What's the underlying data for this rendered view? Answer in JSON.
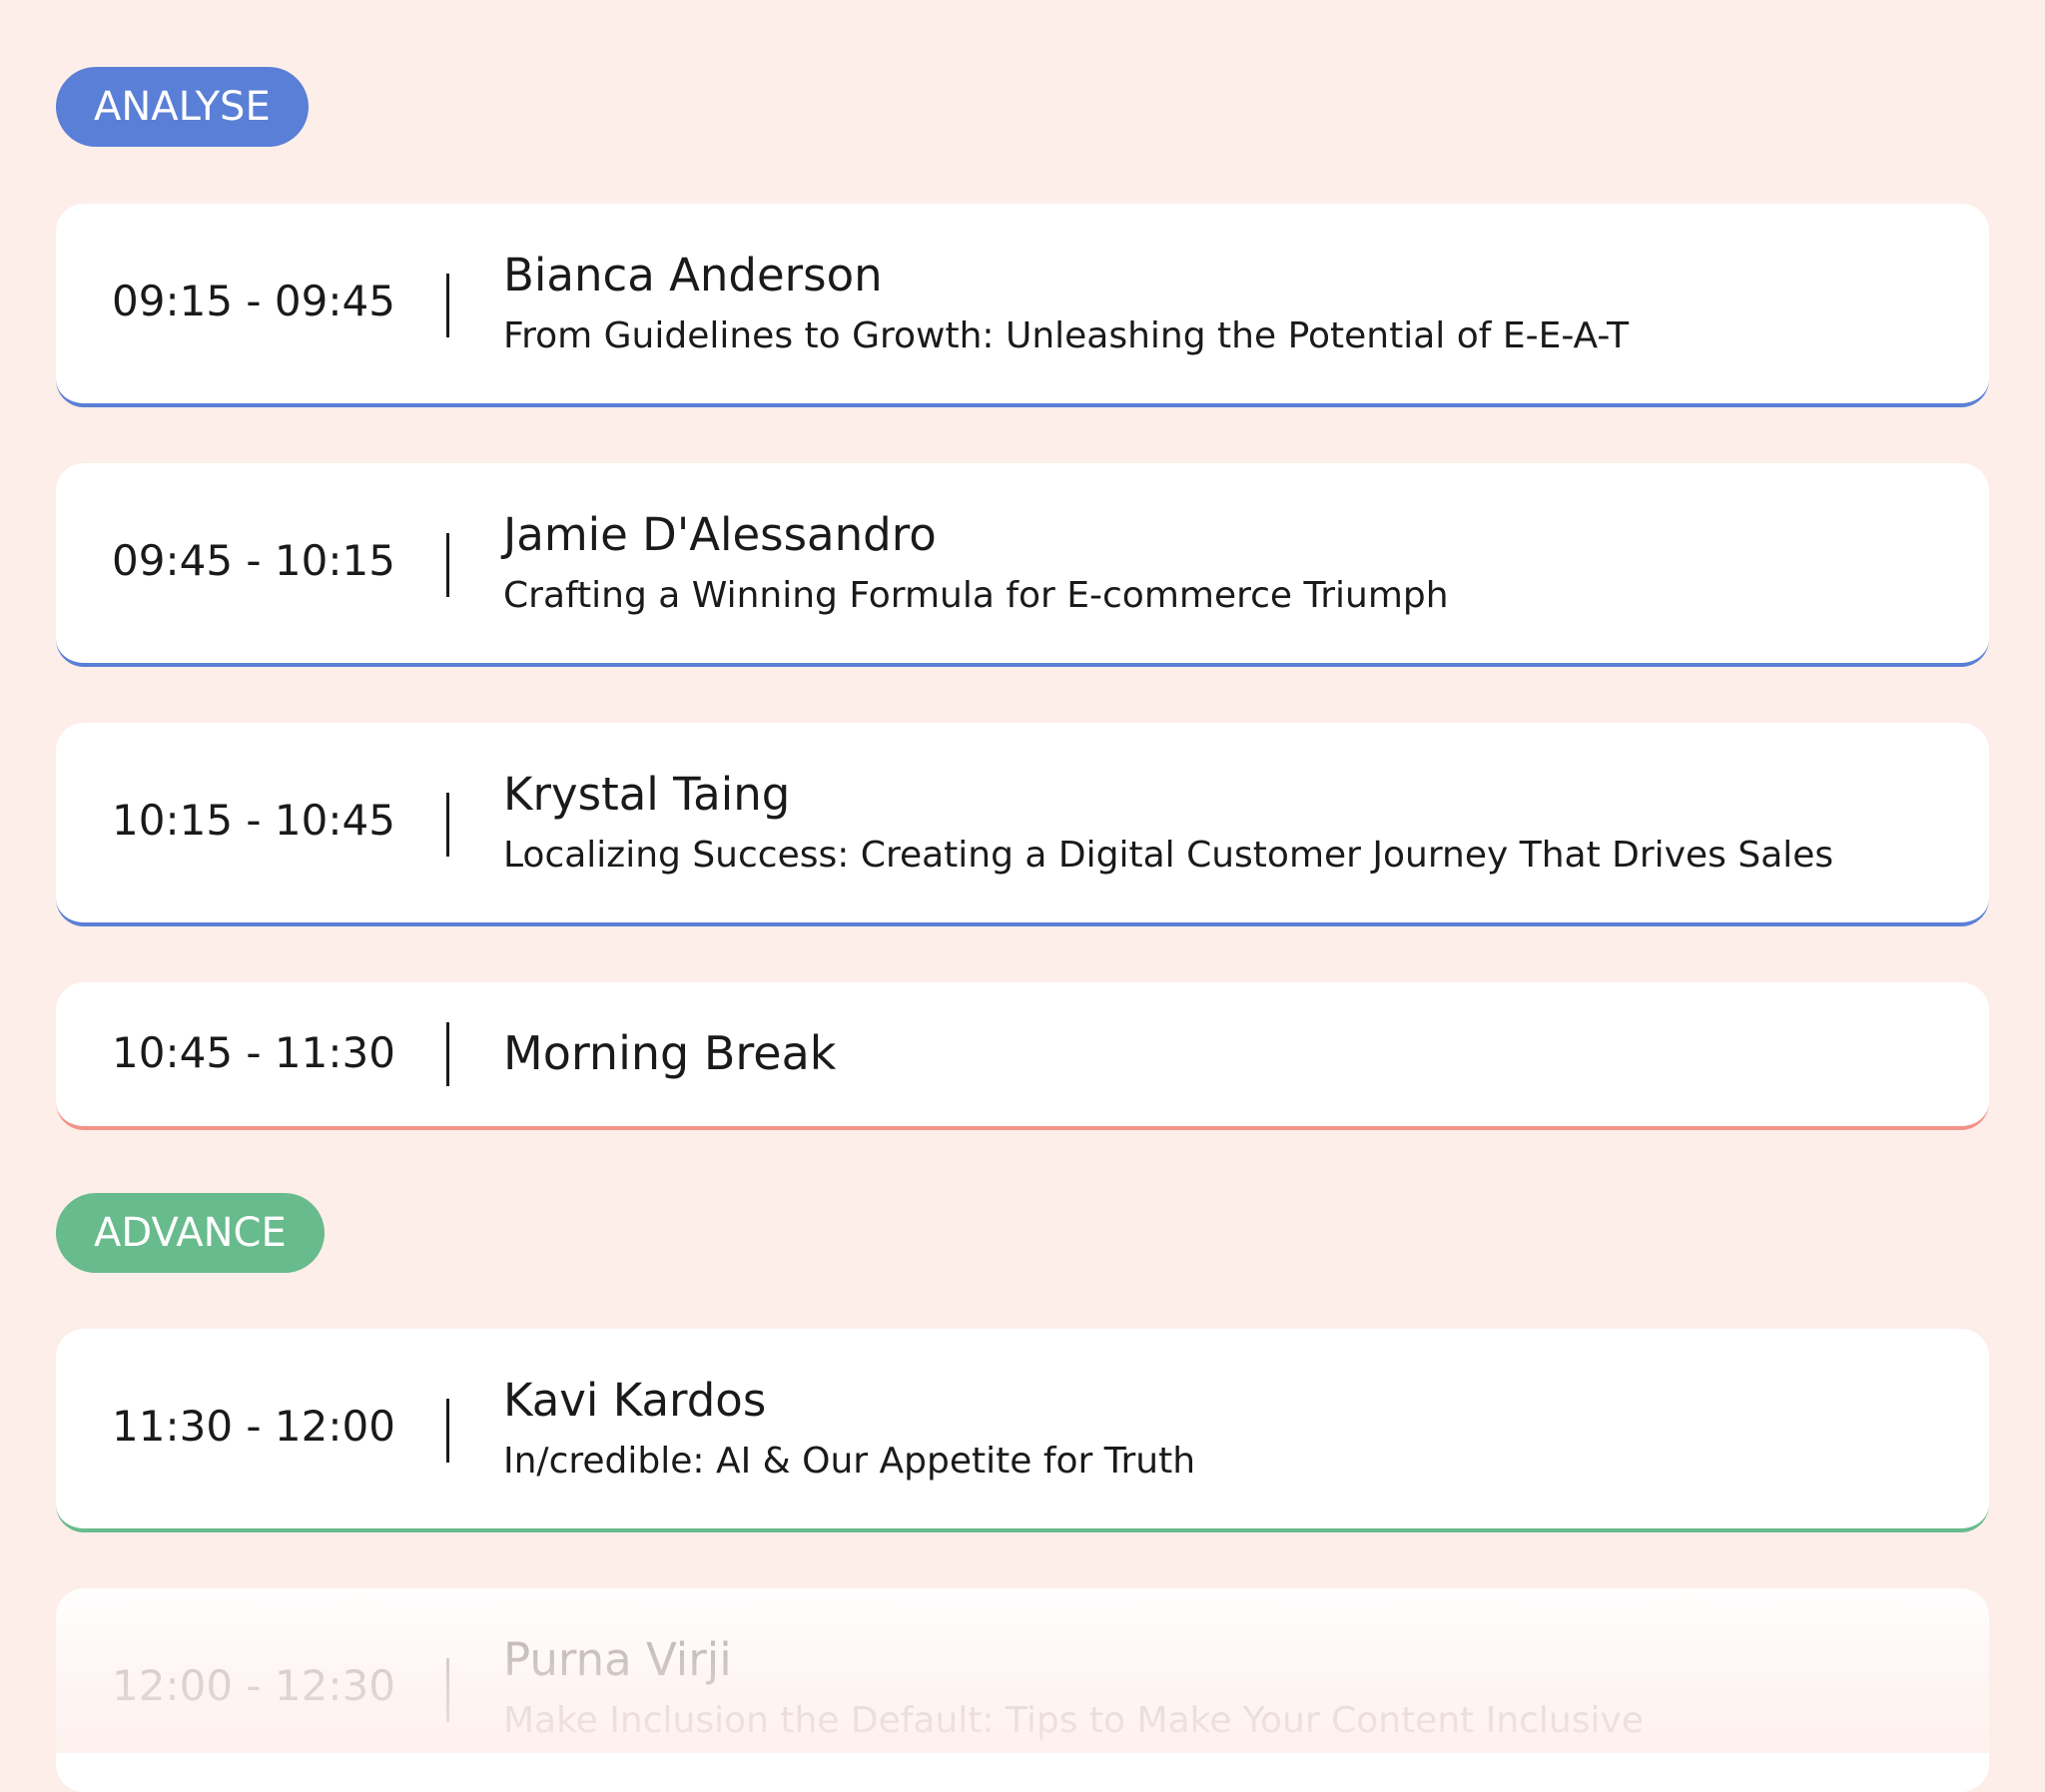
{
  "tracks": {
    "analyse": {
      "label": "ANALYSE",
      "color": "#5a7fd6"
    },
    "advance": {
      "label": "ADVANCE",
      "color": "#68bb8c"
    }
  },
  "break_color": "#f2938a",
  "sessions": [
    {
      "time": "09:15 - 09:45",
      "speaker": "Bianca Anderson",
      "title": "From Guidelines to Growth: Unleashing the Potential of E-E-A-T"
    },
    {
      "time": "09:45 - 10:15",
      "speaker": "Jamie D'Alessandro",
      "title": "Crafting a Winning Formula for E-commerce Triumph"
    },
    {
      "time": "10:15 - 10:45",
      "speaker": "Krystal Taing",
      "title": "Localizing Success: Creating a Digital Customer Journey That Drives Sales"
    },
    {
      "time": "10:45 - 11:30",
      "title": "Morning Break"
    },
    {
      "time": "11:30 - 12:00",
      "speaker": "Kavi Kardos",
      "title": "In/credible: AI & Our Appetite for Truth"
    },
    {
      "time": "12:00 - 12:30",
      "speaker": "Purna Virji",
      "title": "Make Inclusion the Default: Tips to Make Your Content Inclusive"
    }
  ]
}
